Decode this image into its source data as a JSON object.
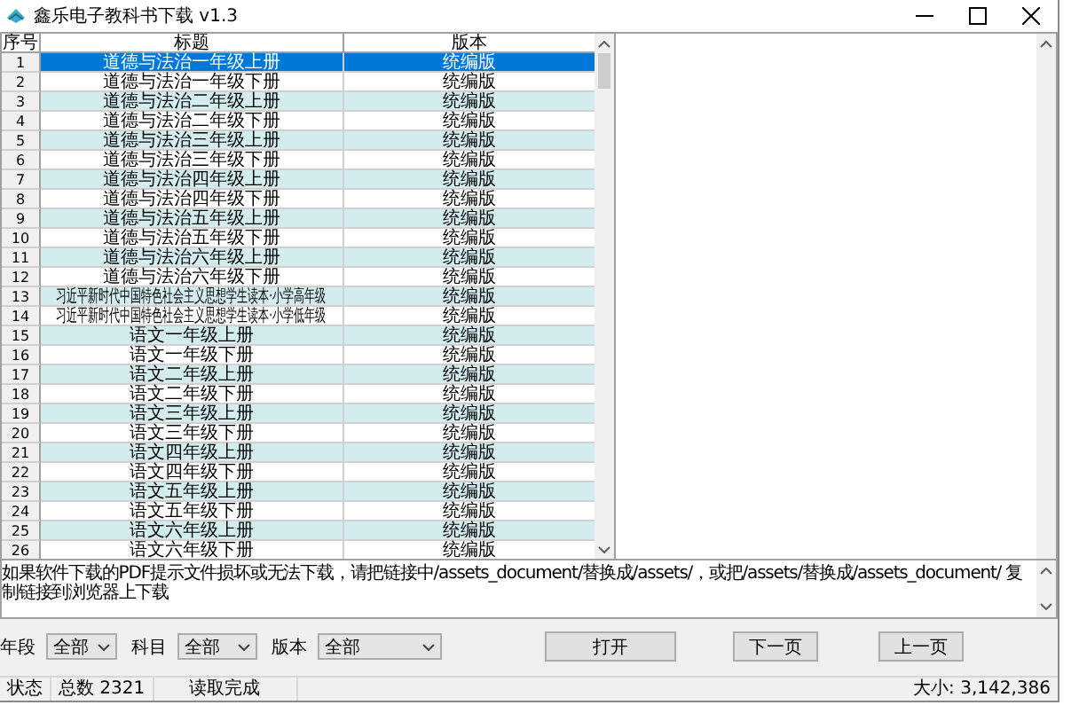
{
  "window": {
    "title": "鑫乐电子教科书下载 v1.3"
  },
  "table": {
    "columns": [
      "序号",
      "标题",
      "版本"
    ],
    "rows": [
      {
        "no": "1",
        "title": "道德与法治一年级上册",
        "edition": "统编版",
        "selected": true
      },
      {
        "no": "2",
        "title": "道德与法治一年级下册",
        "edition": "统编版",
        "selected": false
      },
      {
        "no": "3",
        "title": "道德与法治二年级上册",
        "edition": "统编版",
        "selected": false
      },
      {
        "no": "4",
        "title": "道德与法治二年级下册",
        "edition": "统编版",
        "selected": false
      },
      {
        "no": "5",
        "title": "道德与法治三年级上册",
        "edition": "统编版",
        "selected": false
      },
      {
        "no": "6",
        "title": "道德与法治三年级下册",
        "edition": "统编版",
        "selected": false
      },
      {
        "no": "7",
        "title": "道德与法治四年级上册",
        "edition": "统编版",
        "selected": false
      },
      {
        "no": "8",
        "title": "道德与法治四年级下册",
        "edition": "统编版",
        "selected": false
      },
      {
        "no": "9",
        "title": "道德与法治五年级上册",
        "edition": "统编版",
        "selected": false
      },
      {
        "no": "10",
        "title": "道德与法治五年级下册",
        "edition": "统编版",
        "selected": false
      },
      {
        "no": "11",
        "title": "道德与法治六年级上册",
        "edition": "统编版",
        "selected": false
      },
      {
        "no": "12",
        "title": "道德与法治六年级下册",
        "edition": "统编版",
        "selected": false
      },
      {
        "no": "13",
        "title": "习近平新时代中国特色社会主义思想学生读本·小学高年级",
        "edition": "统编版",
        "selected": false
      },
      {
        "no": "14",
        "title": "习近平新时代中国特色社会主义思想学生读本·小学低年级",
        "edition": "统编版",
        "selected": false
      },
      {
        "no": "15",
        "title": "语文一年级上册",
        "edition": "统编版",
        "selected": false
      },
      {
        "no": "16",
        "title": "语文一年级下册",
        "edition": "统编版",
        "selected": false
      },
      {
        "no": "17",
        "title": "语文二年级上册",
        "edition": "统编版",
        "selected": false
      },
      {
        "no": "18",
        "title": "语文二年级下册",
        "edition": "统编版",
        "selected": false
      },
      {
        "no": "19",
        "title": "语文三年级上册",
        "edition": "统编版",
        "selected": false
      },
      {
        "no": "20",
        "title": "语文三年级下册",
        "edition": "统编版",
        "selected": false
      },
      {
        "no": "21",
        "title": "语文四年级上册",
        "edition": "统编版",
        "selected": false
      },
      {
        "no": "22",
        "title": "语文四年级下册",
        "edition": "统编版",
        "selected": false
      },
      {
        "no": "23",
        "title": "语文五年级上册",
        "edition": "统编版",
        "selected": false
      },
      {
        "no": "24",
        "title": "语文五年级下册",
        "edition": "统编版",
        "selected": false
      },
      {
        "no": "25",
        "title": "语文六年级上册",
        "edition": "统编版",
        "selected": false
      },
      {
        "no": "26",
        "title": "语文六年级下册",
        "edition": "统编版",
        "selected": false
      }
    ]
  },
  "message": "如果软件下载的PDF提示文件损坏或无法下载，请把链接中/assets_document/替换成/assets/，或把/assets/替换成/assets_document/  复制链接到浏览器上下载",
  "filters": [
    {
      "label": "年段",
      "value": "全部"
    },
    {
      "label": "科目",
      "value": "全部"
    },
    {
      "label": "版本",
      "value": "全部"
    }
  ],
  "buttons": [
    "打开",
    "下一页",
    "上一页"
  ],
  "status_bar": [
    "状态",
    "总数 2321",
    "读取完成",
    "大小: 3,142,386"
  ]
}
